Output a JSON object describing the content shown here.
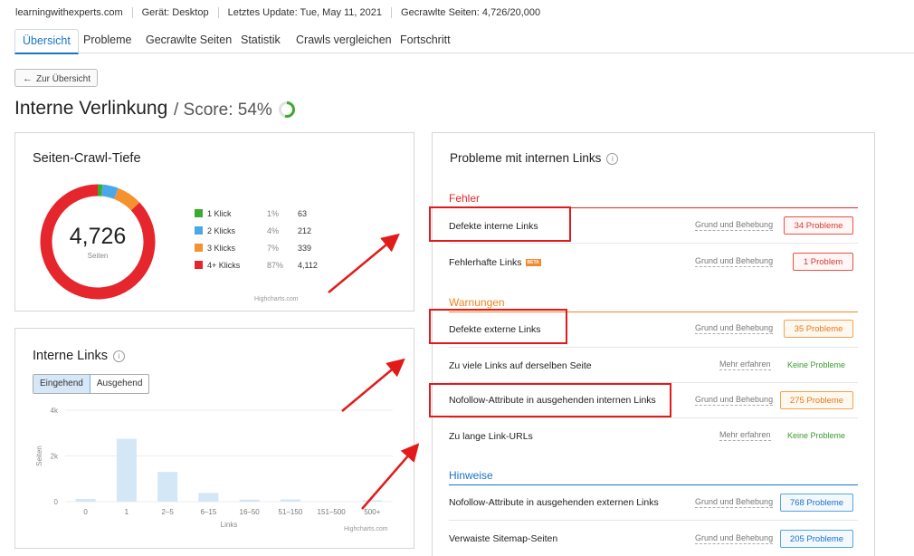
{
  "topbar": {
    "domain": "learningwithexperts.com",
    "device": "Gerät: Desktop",
    "update": "Letztes Update: Tue, May 11, 2021",
    "crawled": "Gecrawlte Seiten: 4,726/20,000"
  },
  "tabs": [
    "Übersicht",
    "Probleme",
    "Gecrawlte Seiten",
    "Statistik",
    "Crawls vergleichen",
    "Fortschritt"
  ],
  "active_tab": "Übersicht",
  "back_label": "Zur Übersicht",
  "page": {
    "title": "Interne Verlinkung",
    "score_label": "/ Score: 54%",
    "score_value": 54,
    "score_color": "#3aab2f"
  },
  "crawl_depth": {
    "title": "Seiten-Crawl-Tiefe",
    "total": "4,726",
    "total_label": "Seiten",
    "legend": [
      {
        "label": "1 Klick",
        "pct": "1%",
        "count": "63",
        "color": "#3aab2f",
        "value": 63
      },
      {
        "label": "2 Klicks",
        "pct": "4%",
        "count": "212",
        "color": "#4aa8ea",
        "value": 212
      },
      {
        "label": "3 Klicks",
        "pct": "7%",
        "count": "339",
        "color": "#f5922f",
        "value": 339
      },
      {
        "label": "4+ Klicks",
        "pct": "87%",
        "count": "4,112",
        "color": "#e5262c",
        "value": 4112
      }
    ],
    "credit": "Highcharts.com"
  },
  "internal_links": {
    "title": "Interne Links",
    "toggle": [
      "Eingehend",
      "Ausgehend"
    ],
    "credit": "Highcharts.com"
  },
  "chart_data": {
    "type": "bar",
    "categories": [
      "0",
      "1",
      "2–5",
      "6–15",
      "16–50",
      "51–150",
      "151–500",
      "500+"
    ],
    "values": [
      120,
      2750,
      1300,
      380,
      90,
      100,
      0,
      60
    ],
    "xlabel": "Links",
    "ylabel": "Seiten",
    "yticks": [
      "0",
      "2k",
      "4k"
    ],
    "ylim": [
      0,
      4000
    ],
    "color": "#d4e7f7"
  },
  "problems": {
    "title": "Probleme mit internen Links",
    "sections": [
      {
        "name": "Fehler",
        "color": "#e5262c",
        "items": [
          {
            "label": "Defekte interne Links",
            "link": "Grund und Behebung",
            "badge": "34 Probleme",
            "kind": "red"
          },
          {
            "label": "Fehlerhafte Links",
            "beta": "BETA",
            "link": "Grund und Behebung",
            "badge": "1 Problem",
            "kind": "red"
          }
        ]
      },
      {
        "name": "Warnungen",
        "color": "#f0851e",
        "items": [
          {
            "label": "Defekte externe Links",
            "link": "Grund und Behebung",
            "badge": "35 Probleme",
            "kind": "orange"
          },
          {
            "label": "Zu viele Links auf derselben Seite",
            "link": "Mehr erfahren",
            "badge": "Keine Probleme",
            "kind": "ok"
          },
          {
            "label": "Nofollow-Attribute in ausgehenden internen Links",
            "link": "Grund und Behebung",
            "badge": "275 Probleme",
            "kind": "orange"
          },
          {
            "label": "Zu lange Link-URLs",
            "link": "Mehr erfahren",
            "badge": "Keine Probleme",
            "kind": "ok"
          }
        ]
      },
      {
        "name": "Hinweise",
        "color": "#1a73c9",
        "items": [
          {
            "label": "Nofollow-Attribute in ausgehenden externen Links",
            "link": "Grund und Behebung",
            "badge": "768 Probleme",
            "kind": "blue"
          },
          {
            "label": "Verwaiste Sitemap-Seiten",
            "link": "Grund und Behebung",
            "badge": "205 Probleme",
            "kind": "blue"
          }
        ]
      }
    ]
  }
}
